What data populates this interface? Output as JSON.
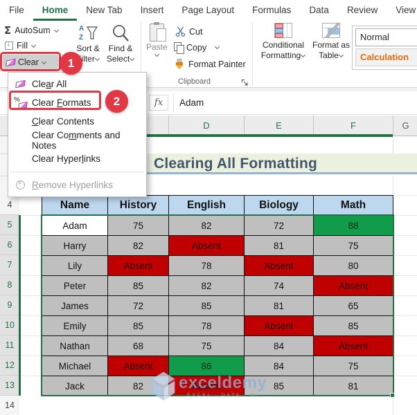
{
  "ribbon": {
    "tabs": [
      {
        "key": "file",
        "label": "File",
        "active": false
      },
      {
        "key": "home",
        "label": "Home",
        "active": true
      },
      {
        "key": "new-tab",
        "label": "New Tab",
        "active": false
      },
      {
        "key": "insert",
        "label": "Insert",
        "active": false
      },
      {
        "key": "page-layout",
        "label": "Page Layout",
        "active": false
      },
      {
        "key": "formulas",
        "label": "Formulas",
        "active": false
      },
      {
        "key": "data",
        "label": "Data",
        "active": false
      },
      {
        "key": "review",
        "label": "Review",
        "active": false
      },
      {
        "key": "view",
        "label": "View",
        "active": false
      }
    ],
    "editing": {
      "autosum": "AutoSum",
      "fill": "Fill",
      "clear": "Clear",
      "sort_line1": "Sort &",
      "sort_line2": "Filter",
      "find_line1": "Find &",
      "find_line2": "Select"
    },
    "clipboard": {
      "paste": "Paste",
      "cut": "Cut",
      "copy": "Copy",
      "format_painter": "Format Painter",
      "group_label": "Clipboard"
    },
    "styles": {
      "conditional_line1": "Conditional",
      "conditional_line2": "Formatting",
      "format_table_line1": "Format as",
      "format_table_line2": "Table",
      "gallery": [
        {
          "label": "Normal",
          "style": "normal"
        },
        {
          "label": "Calculation",
          "style": "calculation"
        }
      ]
    }
  },
  "clear_menu": {
    "items": [
      {
        "key": "clear-all",
        "pre": "Cle",
        "u": "a",
        "post": "r All",
        "icon": "eraser",
        "disabled": false,
        "separator": false
      },
      {
        "key": "clear-formats",
        "pre": "Clear ",
        "u": "F",
        "post": "ormats",
        "icon": "eraser-percent",
        "disabled": false,
        "separator": false,
        "highlighted": true
      },
      {
        "key": "clear-contents",
        "pre": "",
        "u": "C",
        "post": "lear Contents",
        "icon": "",
        "disabled": false,
        "separator": false
      },
      {
        "key": "clear-comments-and-notes",
        "pre": "Clear Co",
        "u": "m",
        "post": "ments and Notes",
        "icon": "",
        "disabled": false,
        "separator": false
      },
      {
        "key": "clear-hyperlinks",
        "pre": "Clear Hyper",
        "u": "l",
        "post": "inks",
        "icon": "",
        "disabled": false,
        "separator": false
      },
      {
        "key": "separator",
        "separator": true
      },
      {
        "key": "remove-hyperlinks",
        "pre": "",
        "u": "R",
        "post": "emove Hyperlinks",
        "icon": "remove-link",
        "disabled": true,
        "separator": false
      }
    ]
  },
  "annotations": {
    "step1": "1",
    "step2": "2"
  },
  "formula_bar": {
    "fx": "fx",
    "value": "Adam"
  },
  "sheet": {
    "column_headers": [
      {
        "letter": "",
        "selected": true
      },
      {
        "letter": "D",
        "selected": true
      },
      {
        "letter": "E",
        "selected": true
      },
      {
        "letter": "F",
        "selected": true
      },
      {
        "letter": "G",
        "selected": false
      }
    ],
    "row_numbers": [
      {
        "n": "4",
        "selected": false
      },
      {
        "n": "5",
        "selected": true
      },
      {
        "n": "6",
        "selected": true
      },
      {
        "n": "7",
        "selected": true
      },
      {
        "n": "8",
        "selected": true
      },
      {
        "n": "9",
        "selected": true
      },
      {
        "n": "10",
        "selected": true
      },
      {
        "n": "11",
        "selected": true
      },
      {
        "n": "12",
        "selected": true
      },
      {
        "n": "13",
        "selected": true
      },
      {
        "n": "14",
        "selected": false
      }
    ]
  },
  "title_banner": "Clearing All Formatting",
  "table": {
    "headers": [
      "Name",
      "History",
      "English",
      "Biology",
      "Math"
    ],
    "rows": [
      {
        "name": "Adam",
        "active": true,
        "cells": [
          {
            "v": "75",
            "s": "gray"
          },
          {
            "v": "82",
            "s": "gray"
          },
          {
            "v": "72",
            "s": "gray"
          },
          {
            "v": "88",
            "s": "green"
          }
        ]
      },
      {
        "name": "Harry",
        "active": false,
        "cells": [
          {
            "v": "82",
            "s": "gray"
          },
          {
            "v": "Absent",
            "s": "red"
          },
          {
            "v": "81",
            "s": "gray"
          },
          {
            "v": "75",
            "s": "gray"
          }
        ]
      },
      {
        "name": "Lily",
        "active": false,
        "cells": [
          {
            "v": "Absent",
            "s": "red"
          },
          {
            "v": "78",
            "s": "gray"
          },
          {
            "v": "Absent",
            "s": "red"
          },
          {
            "v": "80",
            "s": "gray"
          }
        ]
      },
      {
        "name": "Peter",
        "active": false,
        "cells": [
          {
            "v": "85",
            "s": "gray"
          },
          {
            "v": "82",
            "s": "gray"
          },
          {
            "v": "74",
            "s": "gray"
          },
          {
            "v": "Absent",
            "s": "red"
          }
        ]
      },
      {
        "name": "James",
        "active": false,
        "cells": [
          {
            "v": "72",
            "s": "gray"
          },
          {
            "v": "85",
            "s": "gray"
          },
          {
            "v": "81",
            "s": "gray"
          },
          {
            "v": "65",
            "s": "gray"
          }
        ]
      },
      {
        "name": "Emily",
        "active": false,
        "cells": [
          {
            "v": "85",
            "s": "gray"
          },
          {
            "v": "78",
            "s": "gray"
          },
          {
            "v": "Absent",
            "s": "red"
          },
          {
            "v": "85",
            "s": "gray"
          }
        ]
      },
      {
        "name": "Nathan",
        "active": false,
        "cells": [
          {
            "v": "68",
            "s": "gray"
          },
          {
            "v": "75",
            "s": "gray"
          },
          {
            "v": "84",
            "s": "gray"
          },
          {
            "v": "Absent",
            "s": "red"
          }
        ]
      },
      {
        "name": "Michael",
        "active": false,
        "cells": [
          {
            "v": "Absent",
            "s": "red"
          },
          {
            "v": "86",
            "s": "green"
          },
          {
            "v": "84",
            "s": "gray"
          },
          {
            "v": "75",
            "s": "gray"
          }
        ]
      },
      {
        "name": "Jack",
        "active": false,
        "cells": [
          {
            "v": "82",
            "s": "gray"
          },
          {
            "v": "Absent",
            "s": "red"
          },
          {
            "v": "85",
            "s": "gray"
          },
          {
            "v": "81",
            "s": "gray"
          }
        ]
      }
    ]
  },
  "watermark": {
    "brand": "exceldemy",
    "tagline": "EXCEL · DATA · BI"
  },
  "colors": {
    "excel_green": "#217346",
    "annotation_red": "#E23744",
    "absent_red": "#C00000",
    "good_green": "#119C4B",
    "header_blue": "#BDD7EE",
    "cell_gray": "#BFBFBF",
    "title_text": "#44546A",
    "calculation_orange": "#E26B0A"
  }
}
